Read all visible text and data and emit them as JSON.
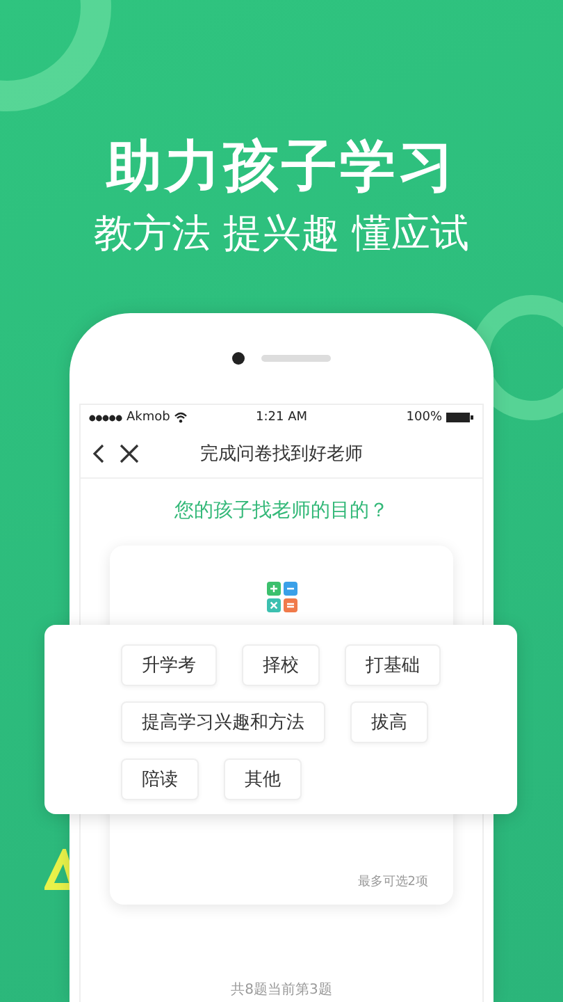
{
  "headline": "助力孩子学习",
  "subheadline": "教方法 提兴趣 懂应试",
  "status_bar": {
    "carrier": "Akmob",
    "time": "1:21 AM",
    "battery": "100%"
  },
  "nav": {
    "title": "完成问卷找到好老师"
  },
  "question": "您的孩子找老师的目的？",
  "option_rows": [
    [
      "升学考",
      "择校",
      "打基础"
    ],
    [
      "提高学习兴趣和方法",
      "拔高"
    ],
    [
      "陪读",
      "其他"
    ]
  ],
  "note": "最多可选2项",
  "progress": "共8题当前第3题"
}
